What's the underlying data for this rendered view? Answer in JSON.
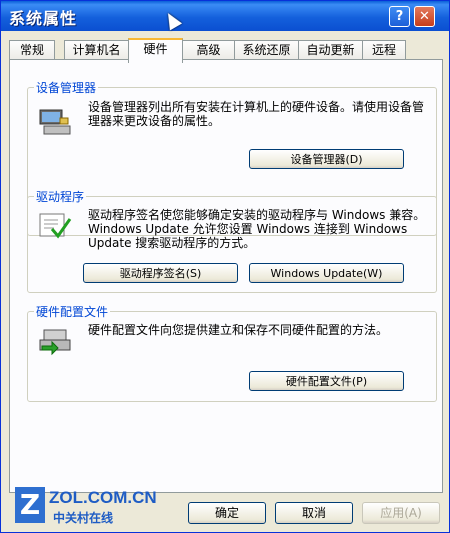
{
  "window": {
    "title": "系统属性"
  },
  "titlebar": {
    "help_label": "?",
    "close_label": "✕"
  },
  "tabs": [
    {
      "label": "常规"
    },
    {
      "label": "计算机名"
    },
    {
      "label": "硬件"
    },
    {
      "label": "高级"
    },
    {
      "label": "系统还原"
    },
    {
      "label": "自动更新"
    },
    {
      "label": "远程"
    }
  ],
  "groups": {
    "device_manager": {
      "title": "设备管理器",
      "description": "设备管理器列出所有安装在计算机上的硬件设备。请使用设备管理器来更改设备的属性。",
      "button": "设备管理器(D)",
      "icon": "device-manager-icon"
    },
    "drivers": {
      "title": "驱动程序",
      "description": "驱动程序签名使您能够确定安装的驱动程序与 Windows 兼容。Windows Update 允许您设置 Windows 连接到 Windows Update 搜索驱动程序的方式。",
      "signing_button": "驱动程序签名(S)",
      "update_button": "Windows Update(W)",
      "icon": "driver-signing-icon"
    },
    "hardware_profiles": {
      "title": "硬件配置文件",
      "description": "硬件配置文件向您提供建立和保存不同硬件配置的方法。",
      "button": "硬件配置文件(P)",
      "icon": "hardware-profile-icon"
    }
  },
  "footer": {
    "ok": "确定",
    "cancel": "取消",
    "apply": "应用(A)"
  },
  "watermark": {
    "site": "ZOL.COM.CN",
    "name": "中关村在线"
  },
  "colors": {
    "titlebar": "#0b4fd1",
    "group_title": "#0046d5",
    "active_tab": "#f8b834"
  }
}
